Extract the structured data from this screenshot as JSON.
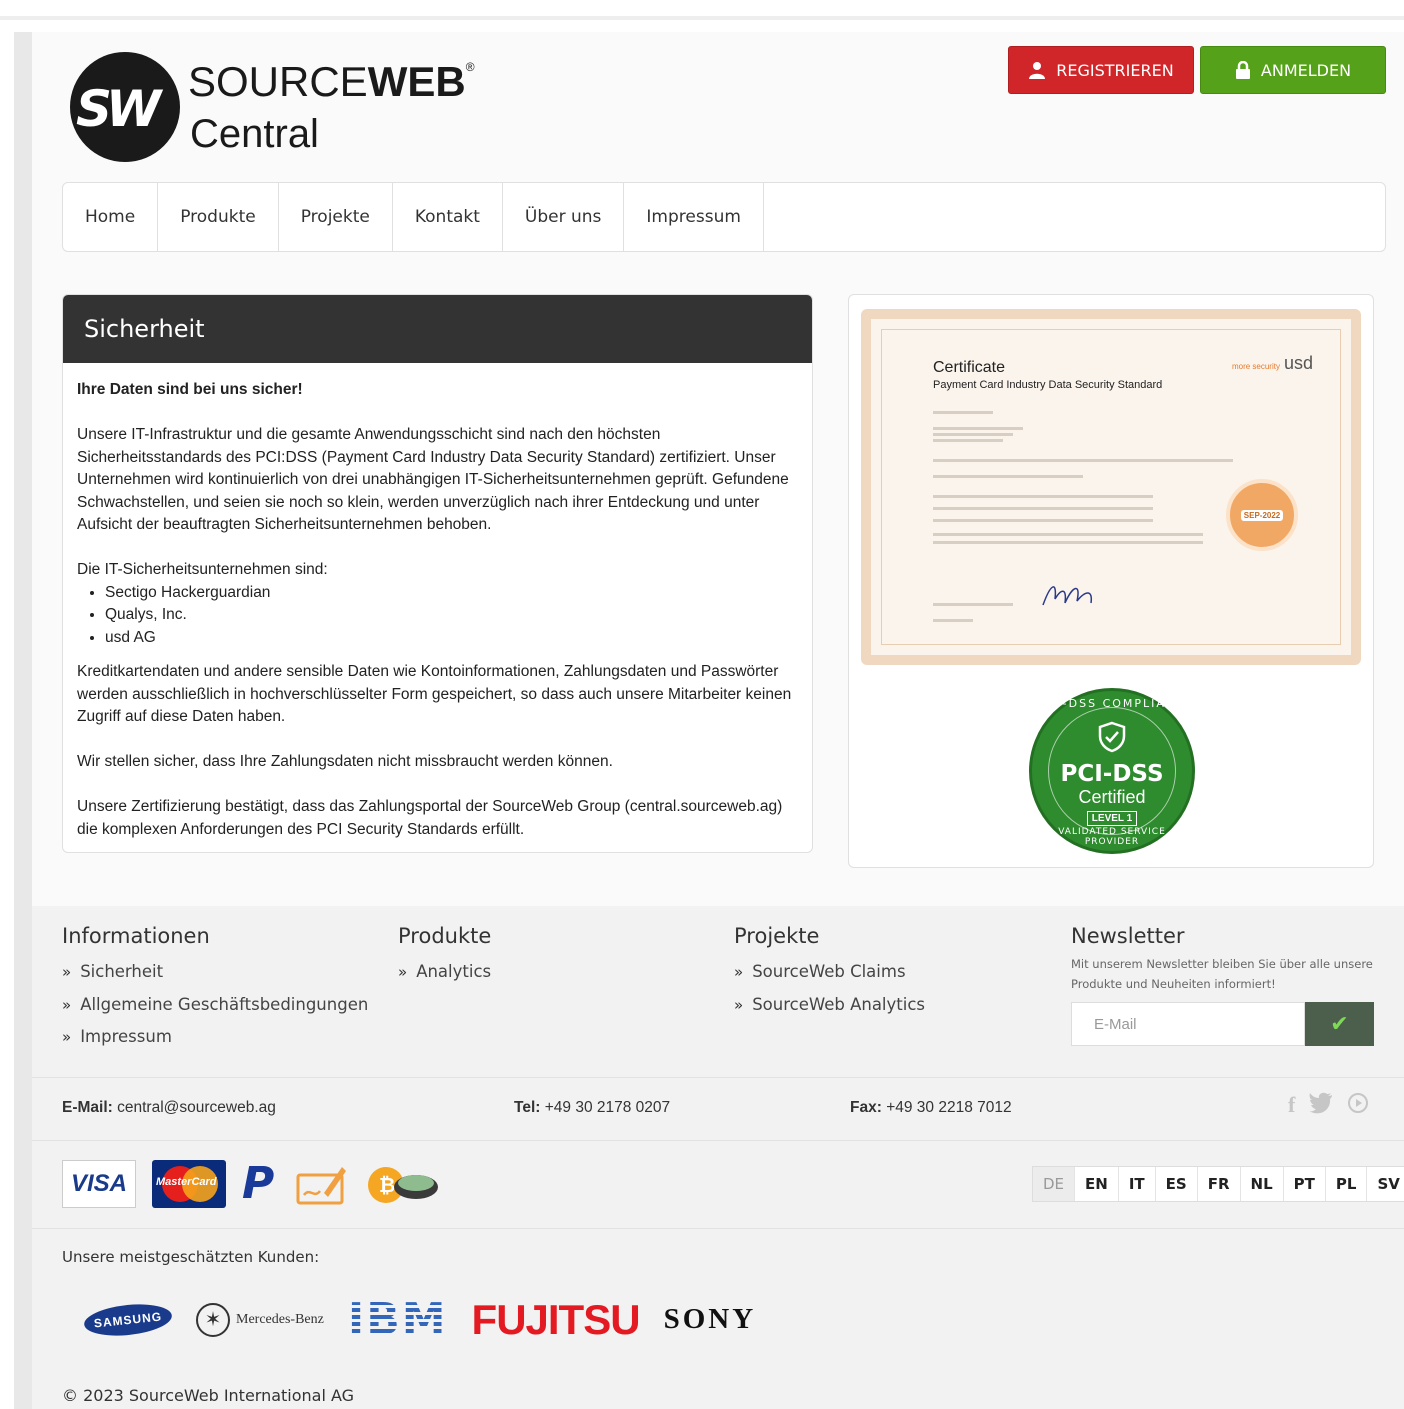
{
  "brand": {
    "monogram": "SW",
    "name_light": "SOURCE",
    "name_bold": "WEB",
    "registered": "®",
    "line2": "Central"
  },
  "auth": {
    "register_label": "REGISTRIEREN",
    "login_label": "ANMELDEN",
    "register_color": "#d0262a",
    "login_color": "#55a11a"
  },
  "nav": {
    "items": [
      {
        "label": "Home"
      },
      {
        "label": "Produkte"
      },
      {
        "label": "Projekte"
      },
      {
        "label": "Kontakt"
      },
      {
        "label": "Über uns"
      },
      {
        "label": "Impressum"
      }
    ]
  },
  "content": {
    "title": "Sicherheit",
    "lead": "Ihre Daten sind bei uns sicher!",
    "p1": "Unsere IT-Infrastruktur und die gesamte Anwendungsschicht sind nach den höchsten Sicherheitsstandards des PCI:DSS (Payment Card Industry Data Security Standard) zertifiziert. Unser Unternehmen wird kontinuierlich von drei unabhängigen IT-Sicherheitsunternehmen geprüft. Gefundene Schwachstellen, und seien sie noch so klein, werden unverzüglich nach ihrer Entdeckung und unter Aufsicht der beauftragten Sicherheitsunternehmen behoben.",
    "list_intro": "Die IT-Sicherheitsunternehmen sind:",
    "companies": [
      "Sectigo Hackerguardian",
      "Qualys, Inc.",
      "usd AG"
    ],
    "p2": "Kreditkartendaten und andere sensible Daten wie Kontoinformationen, Zahlungsdaten und Passwörter werden ausschließlich in hochverschlüsselter Form gespeichert, so dass auch unsere Mitarbeiter keinen Zugriff auf diese Daten haben.",
    "p3": "Wir stellen sicher, dass Ihre Zahlungsdaten nicht missbraucht werden können.",
    "p4": "Unsere Zertifizierung bestätigt, dass das Zahlungsportal der SourceWeb Group (central.sourceweb.ag) die komplexen Anforderungen des PCI Security Standards erfüllt."
  },
  "certificate": {
    "title": "Certificate",
    "subtitle": "Payment Card Industry Data Security Standard",
    "issuer_tag": "more security",
    "issuer": "usd",
    "seal": "SEP-2022"
  },
  "badge": {
    "arc_top": "PCI-DSS COMPLIANT",
    "title": "PCI-DSS",
    "subtitle": "Certified",
    "level": "LEVEL 1",
    "arc_bottom": "VALIDATED SERVICE PROVIDER"
  },
  "footer": {
    "info": {
      "heading": "Informationen",
      "links": [
        "Sicherheit",
        "Allgemeine Geschäftsbedingungen",
        "Impressum"
      ]
    },
    "products": {
      "heading": "Produkte",
      "links": [
        "Analytics"
      ]
    },
    "projects": {
      "heading": "Projekte",
      "links": [
        "SourceWeb Claims",
        "SourceWeb Analytics"
      ]
    },
    "newsletter": {
      "heading": "Newsletter",
      "text": "Mit unserem Newsletter bleiben Sie über alle unsere Produkte und Neuheiten informiert!",
      "placeholder": "E-Mail"
    },
    "contact": {
      "email_label": "E-Mail:",
      "email": "central@sourceweb.ag",
      "tel_label": "Tel:",
      "tel": "+49 30 2178 0207",
      "fax_label": "Fax:",
      "fax": "+49 30 2218 7012"
    },
    "payments": {
      "visa": "VISA",
      "mastercard": "MasterCard",
      "paypal": "P"
    },
    "languages": [
      "DE",
      "EN",
      "IT",
      "ES",
      "FR",
      "NL",
      "PT",
      "PL",
      "SV"
    ],
    "active_language": "DE",
    "customers_label": "Unsere meistgeschätzten Kunden:",
    "customers": {
      "samsung": "SAMSUNG",
      "mercedes": "Mercedes-Benz",
      "ibm": "IBM",
      "fujitsu": "FUJITSU",
      "sony": "SONY"
    },
    "copyright": "© 2023 SourceWeb International AG"
  }
}
